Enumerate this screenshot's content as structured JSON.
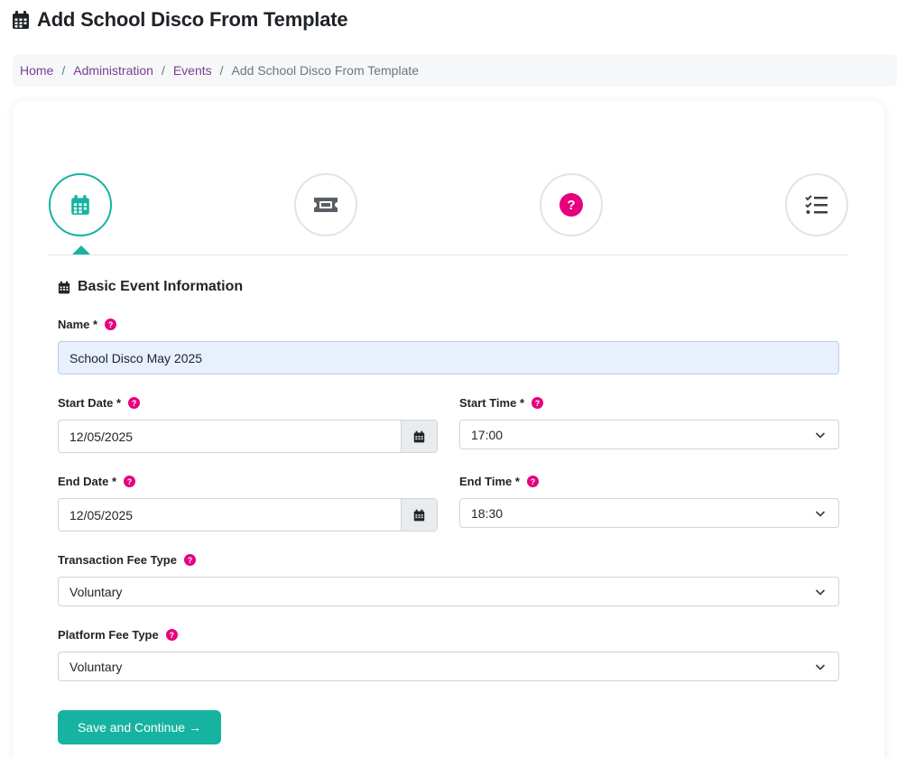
{
  "header": {
    "title": "Add School Disco From Template",
    "icon": "calendar-icon"
  },
  "breadcrumb": {
    "items": [
      "Home",
      "Administration",
      "Events"
    ],
    "current": "Add School Disco From Template",
    "separator": "/"
  },
  "wizard": {
    "steps": [
      {
        "icon": "calendar-icon",
        "active": true
      },
      {
        "icon": "ticket-icon",
        "active": false
      },
      {
        "icon": "question-icon",
        "active": false
      },
      {
        "icon": "checklist-icon",
        "active": false
      }
    ],
    "accent": "#16b3a0"
  },
  "form": {
    "section_title": "Basic Event Information",
    "name": {
      "label": "Name *",
      "value": "School Disco May 2025"
    },
    "start_date": {
      "label": "Start Date *",
      "value": "12/05/2025"
    },
    "start_time": {
      "label": "Start Time *",
      "value": "17:00"
    },
    "end_date": {
      "label": "End Date *",
      "value": "12/05/2025"
    },
    "end_time": {
      "label": "End Time *",
      "value": "18:30"
    },
    "transaction_fee_type": {
      "label": "Transaction Fee Type",
      "value": "Voluntary"
    },
    "platform_fee_type": {
      "label": "Platform Fee Type",
      "value": "Voluntary"
    },
    "help_glyph": "?",
    "submit_label": "Save and Continue",
    "submit_arrow": "→"
  },
  "colors": {
    "primary": "#16b3a0",
    "help": "#e6007e",
    "link": "#7b3f8f"
  }
}
